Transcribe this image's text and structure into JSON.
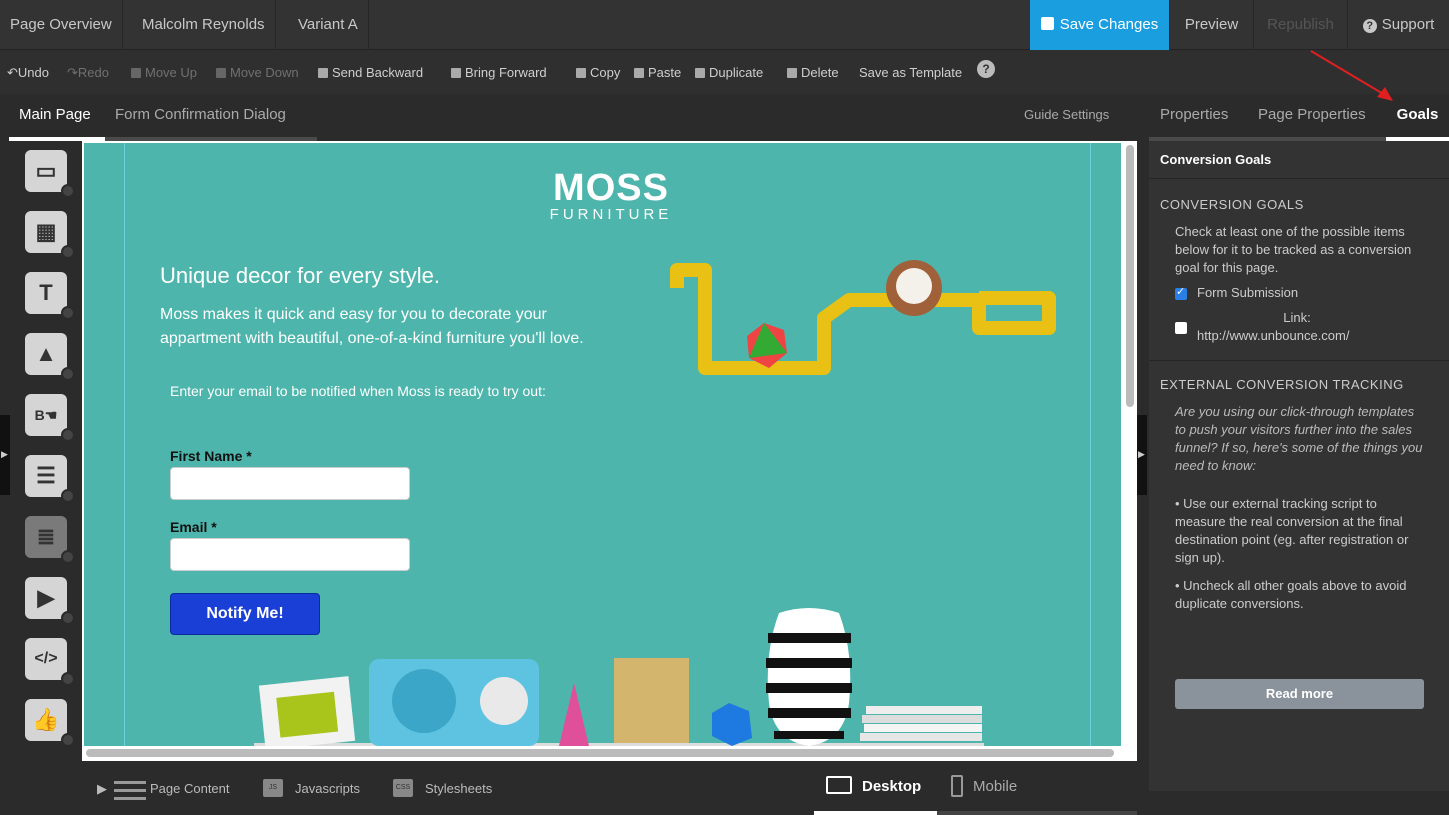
{
  "topbar": {
    "crumbs": [
      "Page Overview",
      "Malcolm Reynolds",
      "Variant A"
    ],
    "save_label": "Save Changes",
    "preview_label": "Preview",
    "republish_label": "Republish",
    "support_label": "Support"
  },
  "toolbar": {
    "undo": "Undo",
    "redo": "Redo",
    "move_up": "Move Up",
    "move_down": "Move Down",
    "send_backward": "Send Backward",
    "bring_forward": "Bring Forward",
    "copy": "Copy",
    "paste": "Paste",
    "duplicate": "Duplicate",
    "delete": "Delete",
    "save_template": "Save as Template",
    "help": "?"
  },
  "editor_tabs": {
    "main": "Main Page",
    "confirm": "Form Confirmation Dialog",
    "guide_settings": "Guide Settings"
  },
  "canvas": {
    "brand_top": "MOSS",
    "brand_bottom": "FURNITURE",
    "headline": "Unique decor for every style.",
    "subline": "Moss makes it quick and easy for you to decorate your appartment with beautiful, one-of-a-kind furniture you'll love.",
    "enter_text": "Enter your email to be notified when Moss is ready to try out:",
    "first_name_label": "First Name *",
    "email_label": "Email *",
    "notify_label": "Notify Me!"
  },
  "bottombar": {
    "page_content": "Page Content",
    "javascripts": "Javascripts",
    "stylesheets": "Stylesheets",
    "desktop": "Desktop",
    "mobile": "Mobile",
    "js_badge": "JS",
    "css_badge": "CSS"
  },
  "right_panel": {
    "tabs": [
      "Properties",
      "Page Properties",
      "Goals"
    ],
    "header": "Conversion Goals",
    "conv_title": "CONVERSION GOALS",
    "conv_text": "Check at least one of the possible items below for it to be tracked as a conversion goal for this page.",
    "goal_form": "Form Submission",
    "goal_link_label": "Link:",
    "goal_link_url": "http://www.unbounce.com/",
    "ext_title": "EXTERNAL CONVERSION TRACKING",
    "ext_text": "Are you using our click-through templates to push your visitors further into the sales funnel? If so, here's some of the things you need to know:",
    "bullet1": "• Use our external tracking script to measure the real conversion at the final destination point (eg. after registration or sign up).",
    "bullet2": "• Uncheck all other goals above to avoid duplicate conversions.",
    "read_more": "Read more"
  },
  "colors": {
    "accent": "#1a9ee0",
    "canvas_bg": "#4db5ab",
    "notify": "#1a3fd6",
    "annotation_arrow": "#e02020"
  }
}
